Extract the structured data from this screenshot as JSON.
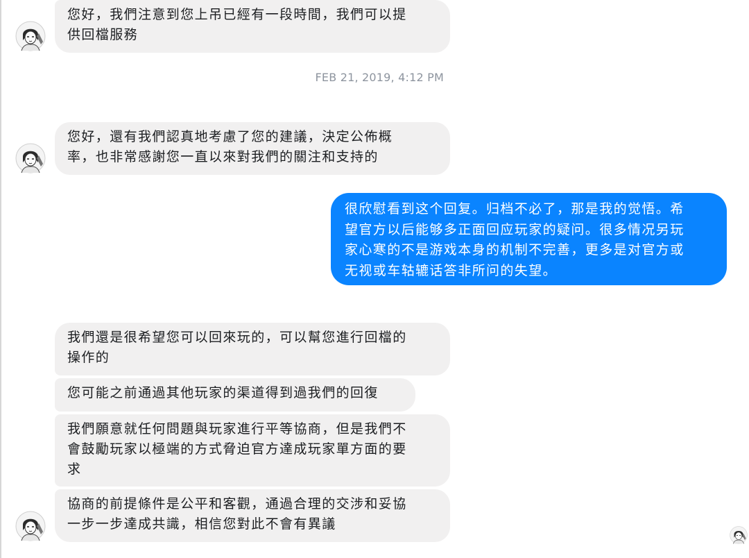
{
  "thread": {
    "group1": {
      "msg1": "您好，我們注意到您上吊已經有一段時間，我們可以提\n供回檔服務"
    },
    "timestamp": "FEB 21, 2019, 4:12 PM",
    "group2": {
      "msg1": "您好，還有我們認真地考慮了您的建議，決定公佈概\n率，也非常感謝您一直以來對我們的關注和支持的"
    },
    "outgoing": {
      "msg1": "很欣慰看到这个回复。归档不必了，那是我的觉悟。希\n望官方以后能够多正面回应玩家的疑问。很多情况另玩\n家心寒的不是游戏本身的机制不完善，更多是对官方或\n无视或车轱辘话答非所问的失望。"
    },
    "group3": {
      "msg1": "我們還是很希望您可以回來玩的，可以幫您進行回檔的\n操作的",
      "msg2": "您可能之前通過其他玩家的渠道得到過我們的回復",
      "msg3": "我們願意就任何問題與玩家進行平等協商，但是我們不\n會鼓勵玩家以極端的方式脅迫官方達成玩家單方面的要\n求",
      "msg4": "協商的前提條件是公平和客觀，通過合理的交涉和妥協\n一步一步達成共識，相信您對此不會有異議"
    }
  },
  "colors": {
    "incoming_bubble": "#f1f0f0",
    "outgoing_bubble": "#0a84ff",
    "timestamp_text": "#8d949e"
  },
  "icons": {
    "sender_avatar": "sketch-portrait-avatar",
    "seen_indicator": "sketch-portrait-avatar-small"
  }
}
